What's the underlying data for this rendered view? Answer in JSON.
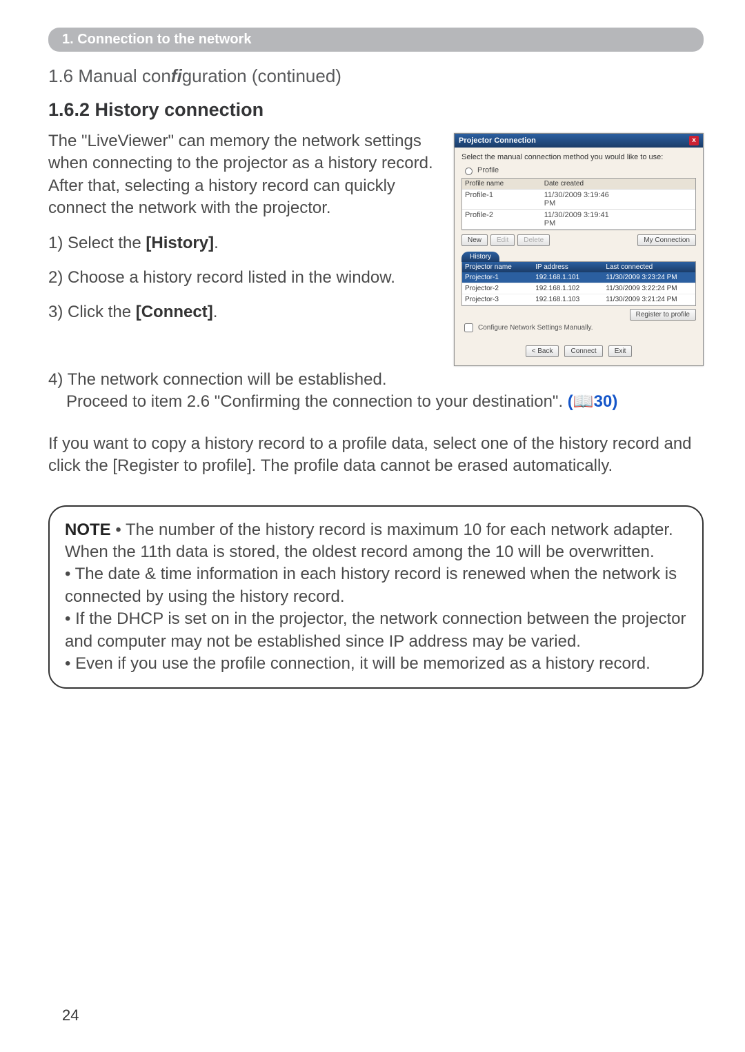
{
  "banner": {
    "text": "1. Connection to the network"
  },
  "subtitle_pre": "1.6 Manual con",
  "subtitle_fi": "fi",
  "subtitle_post": "guration (continued)",
  "section_title": "1.6.2 History connection",
  "intro": "The \"LiveViewer\" can memory the network settings when connecting to the projector as a history record. After that, selecting a history record can quickly connect the network with the projector.",
  "step1_pre": "1) Select the ",
  "step1_bold": "[History]",
  "step1_post": ".",
  "step2": "2) Choose a history record listed in the window.",
  "step3_pre": "3) Click the ",
  "step3_bold": "[Connect]",
  "step3_post": ".",
  "step4_line1": "4) The network connection will be established.",
  "step4_indent": "Proceed to item 2.6 \"Confirming the connection to your destination\". ",
  "step4_pgref": "(📖30)",
  "copy_para": "If you want to copy a history record to a proﬁle data, select one of the history record and click the [Register to proﬁle]. The proﬁle data cannot be erased automatically.",
  "note_label": "NOTE",
  "note_bullets": [
    "• The number of the history record is maximum 10 for each network adapter. When the 11th data is stored, the oldest record among the 10 will be overwritten.",
    "• The date & time information in each history record is renewed when the network is connected by using the history record.",
    "• If the DHCP is set on in the projector, the network connection between the projector and computer may not be established since IP address may be varied.",
    "• Even if you use the proﬁle connection, it will be memorized as a history record."
  ],
  "page_number": "24",
  "dialog": {
    "title": "Projector Connection",
    "close": "x",
    "instr": "Select the manual connection method you would like to use:",
    "radio_profile": "Profile",
    "profile_head": {
      "c1": "Profile name",
      "c2": "Date created"
    },
    "profile_rows": [
      {
        "c1": "Profile-1",
        "c2": "11/30/2009 3:19:46 PM"
      },
      {
        "c1": "Profile-2",
        "c2": "11/30/2009 3:19:41 PM"
      }
    ],
    "btn_new": "New",
    "btn_edit": "Edit",
    "btn_delete": "Delete",
    "btn_myconn": "My Connection",
    "tab_history": "History",
    "hist_head": {
      "h1": "Projector name",
      "h2": "IP address",
      "h3": "Last connected"
    },
    "hist_rows": [
      {
        "h1": "Projector-1",
        "h2": "192.168.1.101",
        "h3": "11/30/2009 3:23:24 PM",
        "sel": true
      },
      {
        "h1": "Projector-2",
        "h2": "192.168.1.102",
        "h3": "11/30/2009 3:22:24 PM",
        "sel": false
      },
      {
        "h1": "Projector-3",
        "h2": "192.168.1.103",
        "h3": "11/30/2009 3:21:24 PM",
        "sel": false
      }
    ],
    "btn_register": "Register to profile",
    "chk_manual": "Configure Network Settings Manually.",
    "btn_back": "< Back",
    "btn_connect": "Connect",
    "btn_exit": "Exit"
  }
}
